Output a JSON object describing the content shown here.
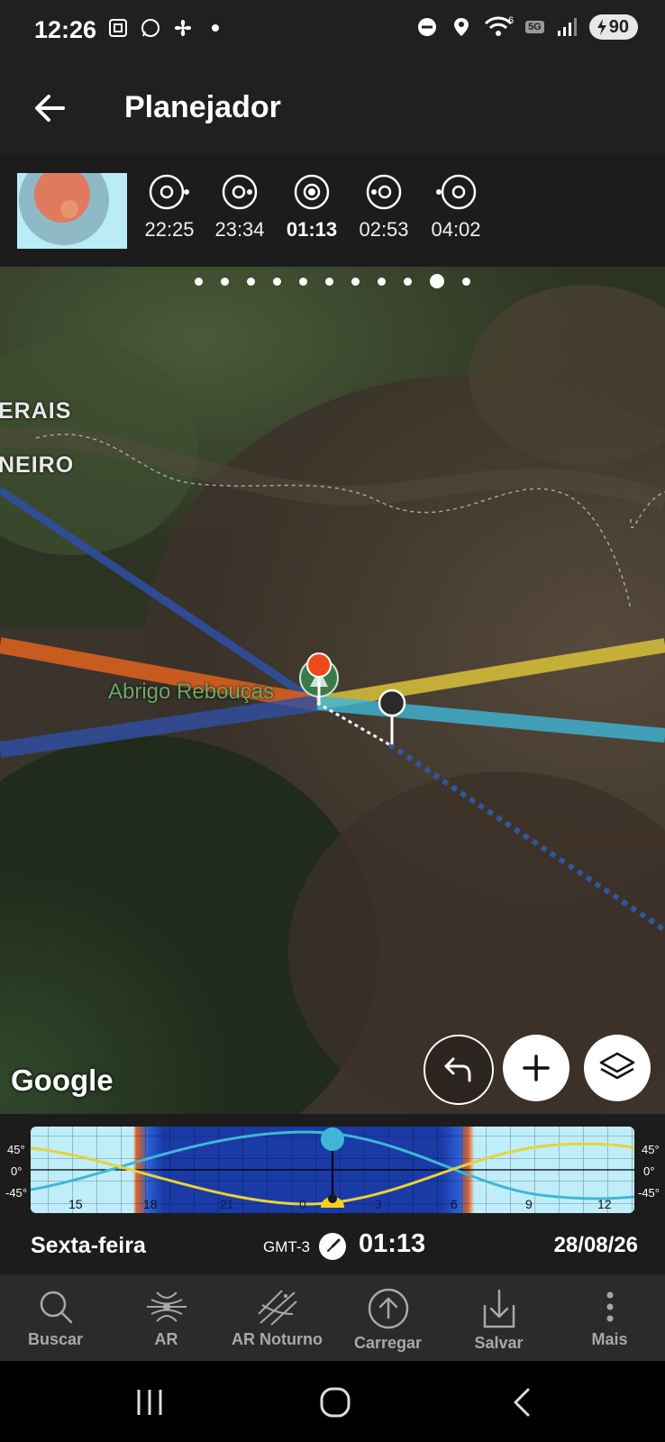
{
  "status_bar": {
    "time": "12:26",
    "left_icons": [
      "screenshot-icon",
      "whatsapp-icon",
      "fan-icon",
      "dot-icon"
    ],
    "right_icons": [
      "dnd-icon",
      "location-icon",
      "wifi-icon",
      "5g-icon",
      "signal-icon"
    ],
    "network_label": "5G",
    "wifi_label": "6",
    "battery": "90"
  },
  "app_bar": {
    "title": "Planejador",
    "back_icon": "arrow-left-icon"
  },
  "moon_phases": {
    "items": [
      {
        "time": "22:25",
        "active": false
      },
      {
        "time": "23:34",
        "active": false
      },
      {
        "time": "01:13",
        "active": true
      },
      {
        "time": "02:53",
        "active": false
      },
      {
        "time": "04:02",
        "active": false
      }
    ]
  },
  "map": {
    "page_dots": 11,
    "active_dot": 9,
    "labels": {
      "region1": "ERAIS",
      "region2": "NEIRO",
      "place": "Abrigo Rebouças"
    },
    "attribution": "Google",
    "colors": {
      "sun_line": "#d9c23a",
      "sun_set": "#e0621e",
      "moon_line": "#3fb6d8",
      "moon_set": "#2f4fa6"
    },
    "buttons": {
      "undo_icon": "undo-icon",
      "add_icon": "plus-icon",
      "layers_icon": "layers-icon"
    }
  },
  "timeline": {
    "deg_labels": [
      "45°",
      "0°",
      "-45°"
    ],
    "hour_labels": [
      "15",
      "18",
      "21",
      "0",
      "3",
      "6",
      "9",
      "12"
    ]
  },
  "date_row": {
    "weekday": "Sexta-feira",
    "timezone": "GMT-3",
    "time": "01:13",
    "date": "28/08/26"
  },
  "bottom_nav": {
    "items": [
      {
        "label": "Buscar",
        "icon": "search-icon"
      },
      {
        "label": "AR",
        "icon": "ar-icon"
      },
      {
        "label": "AR Noturno",
        "icon": "ar-night-icon"
      },
      {
        "label": "Carregar",
        "icon": "upload-icon"
      },
      {
        "label": "Salvar",
        "icon": "save-icon"
      },
      {
        "label": "Mais",
        "icon": "more-icon"
      }
    ]
  }
}
